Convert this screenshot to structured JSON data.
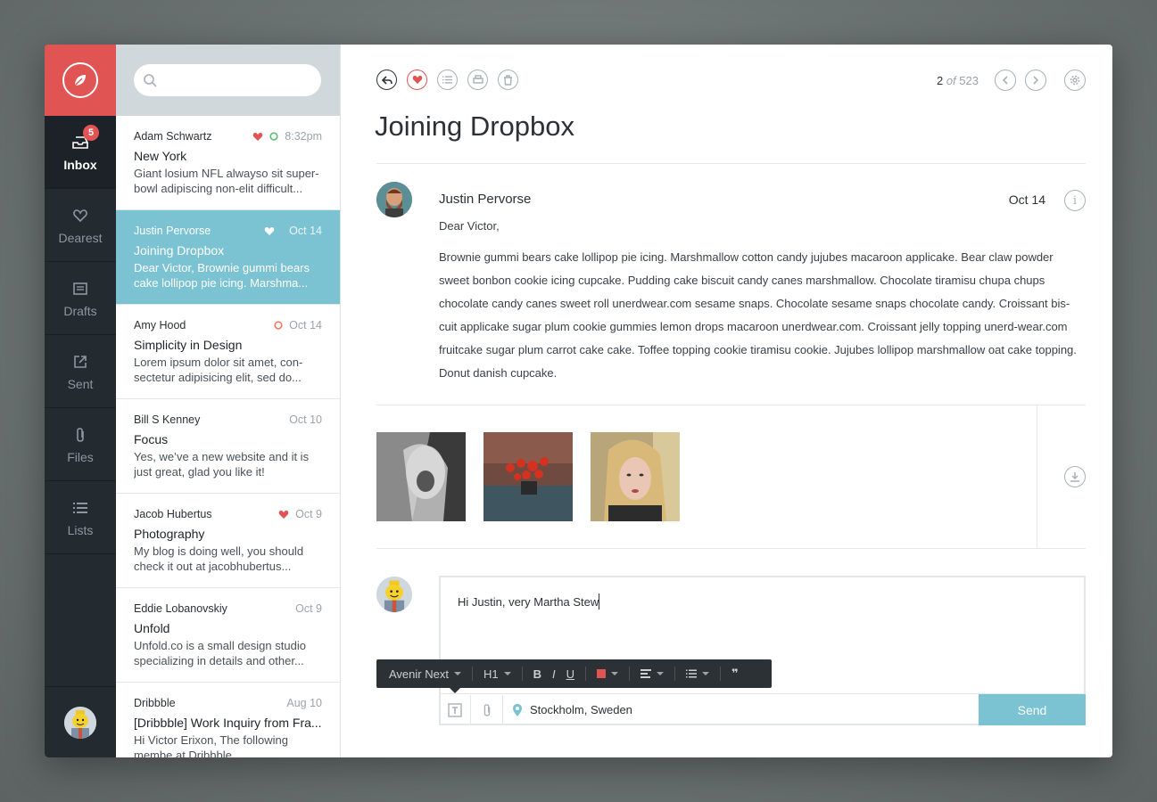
{
  "sidebar": {
    "items": [
      {
        "label": "Inbox",
        "icon": "inbox-icon",
        "badge": "5"
      },
      {
        "label": "Dearest",
        "icon": "heart-icon"
      },
      {
        "label": "Drafts",
        "icon": "drafts-icon"
      },
      {
        "label": "Sent",
        "icon": "sent-icon"
      },
      {
        "label": "Files",
        "icon": "paperclip-icon"
      },
      {
        "label": "Lists",
        "icon": "list-icon"
      }
    ]
  },
  "messages": [
    {
      "sender": "Adam Schwartz",
      "time": "8:32pm",
      "subject": "New York",
      "preview": "Giant losium NFL alwayso sit super-bowl adipiscing non-elit difficult..."
    },
    {
      "sender": "Justin Pervorse",
      "time": "Oct 14",
      "subject": "Joining Dropbox",
      "preview": "Dear Victor, Brownie gummi bears cake lollipop pie icing. Marshma..."
    },
    {
      "sender": "Amy Hood",
      "time": "Oct 14",
      "subject": "Simplicity in Design",
      "preview": "Lorem ipsum dolor sit amet, con-sectetur adipisicing elit, sed do..."
    },
    {
      "sender": "Bill S Kenney",
      "time": "Oct 10",
      "subject": "Focus",
      "preview": "Yes, we’ve a new website and it is just great, glad you like it!"
    },
    {
      "sender": "Jacob Hubertus",
      "time": "Oct 9",
      "subject": "Photography",
      "preview": "My blog is doing well, you should check it out at jacobhubertus..."
    },
    {
      "sender": "Eddie Lobanovskiy",
      "time": "Oct 9",
      "subject": "Unfold",
      "preview": "Unfold.co is a small design studio specializing in details and other..."
    },
    {
      "sender": "Dribbble",
      "time": "Aug 10",
      "subject": "[Dribbble] Work Inquiry from Fra...",
      "preview": "Hi Victor Erixon, The following membe at Dribbble..."
    }
  ],
  "pager": {
    "current": "2",
    "of_label": "of",
    "total": "523"
  },
  "email": {
    "title": "Joining Dropbox",
    "author": "Justin Pervorse",
    "date": "Oct 14",
    "greeting": "Dear Victor,",
    "body": "Brownie gummi bears cake lollipop pie icing. Marshmallow cotton candy jujubes macaroon applicake. Bear claw powder sweet bonbon cookie icing cupcake. Pudding cake biscuit candy canes marshmallow. Chocolate tiramisu chupa chups chocolate candy canes sweet roll unerdwear.com sesame snaps. Chocolate sesame snaps chocolate candy. Croissant bis-cuit applicake sugar plum cookie gummies lemon drops macaroon unerdwear.com. Croissant jelly topping unerd-wear.com fruitcake sugar plum carrot cake cake. Toffee topping cookie tiramisu cookie. Jujubes lollipop marshmallow oat cake topping. Donut danish cupcake."
  },
  "reply": {
    "text": "Hi Justin, very Martha Stew",
    "font": "Avenir Next",
    "heading": "H1",
    "bold": "B",
    "italic": "I",
    "underline": "U",
    "quote": "❞",
    "location_city": "Stockholm,",
    "location_country": "Sweden",
    "send_label": "Send"
  },
  "colors": {
    "accent_red": "#e05454",
    "accent_teal": "#7bc3d3",
    "sidebar_bg": "#232a30"
  }
}
